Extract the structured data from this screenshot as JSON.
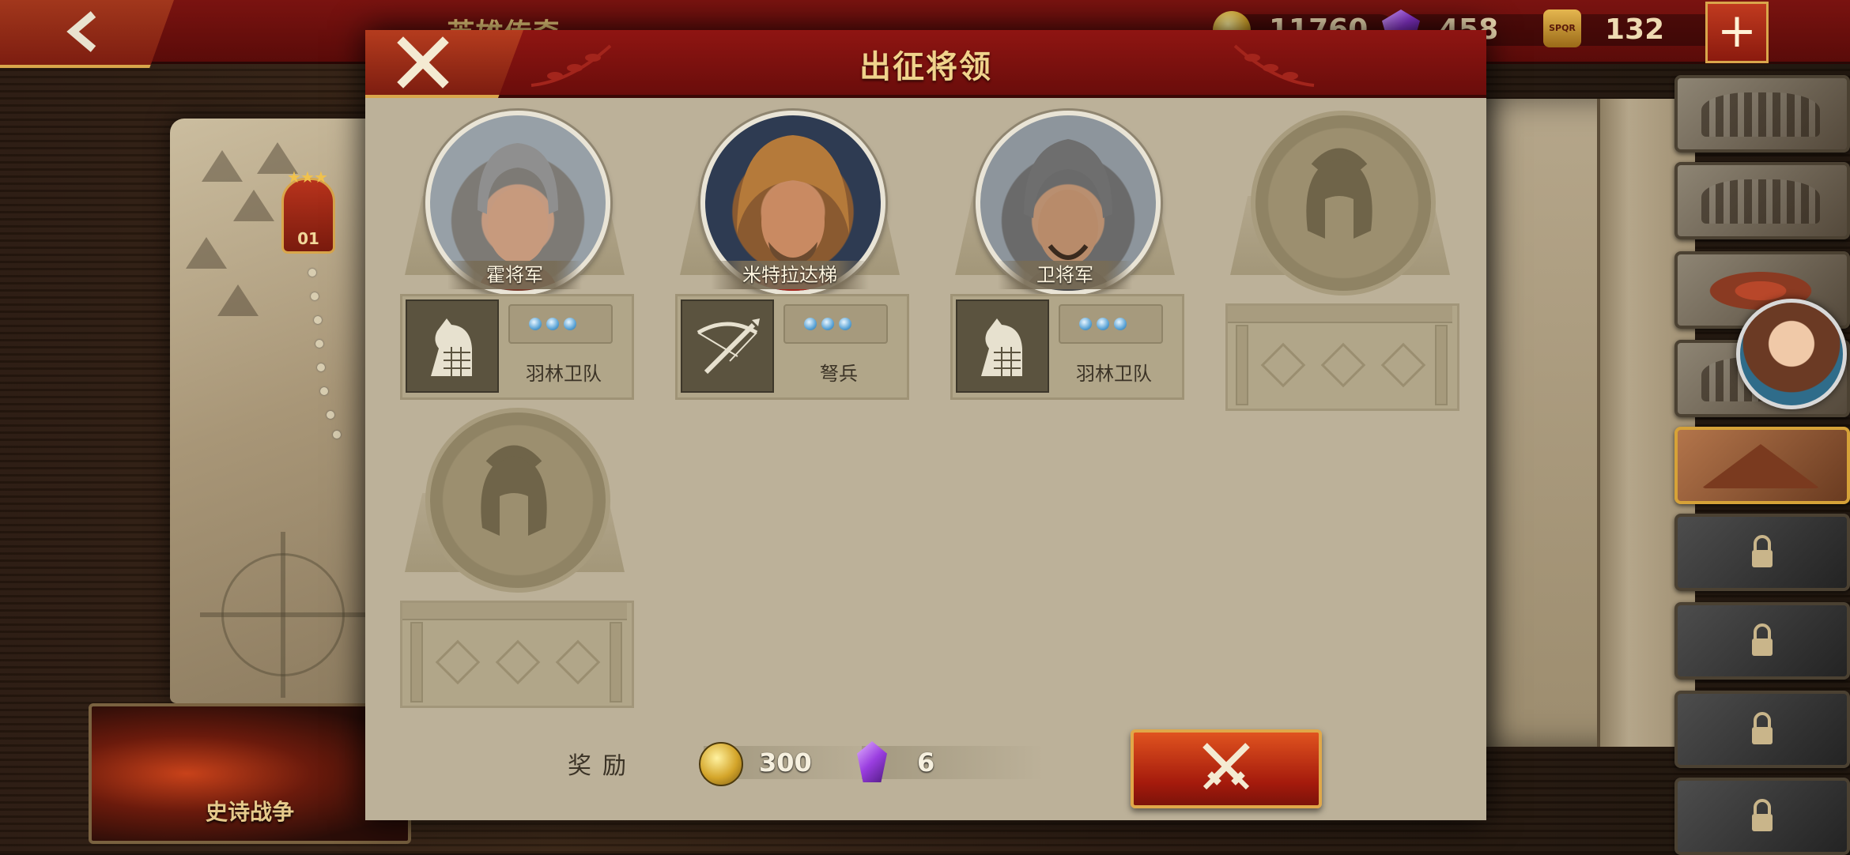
{
  "topbar": {
    "title": "英雄传奇",
    "gold": "11760",
    "gems": "458",
    "spqr": "132",
    "spqr_label": "SPQR"
  },
  "map": {
    "level_badge": "01"
  },
  "epic_war": {
    "label": "史诗战争"
  },
  "modal": {
    "title": "出征将领",
    "heroes": [
      {
        "name": "霍将军",
        "unit": "羽林卫队",
        "unit_icon": "horse-icon",
        "stars": 3
      },
      {
        "name": "米特拉达梯",
        "unit": "弩兵",
        "unit_icon": "crossbow-icon",
        "stars": 3
      },
      {
        "name": "卫将军",
        "unit": "羽林卫队",
        "unit_icon": "horse-icon",
        "stars": 3
      }
    ],
    "empty_slots": 2,
    "reward": {
      "label": "奖励",
      "gold": "300",
      "gems": "6"
    }
  },
  "colors": {
    "header_red": "#7a1310",
    "panel_parchment": "#bcb199",
    "gold_text": "#f0d38c",
    "star_blue": "#5aa3d6"
  }
}
